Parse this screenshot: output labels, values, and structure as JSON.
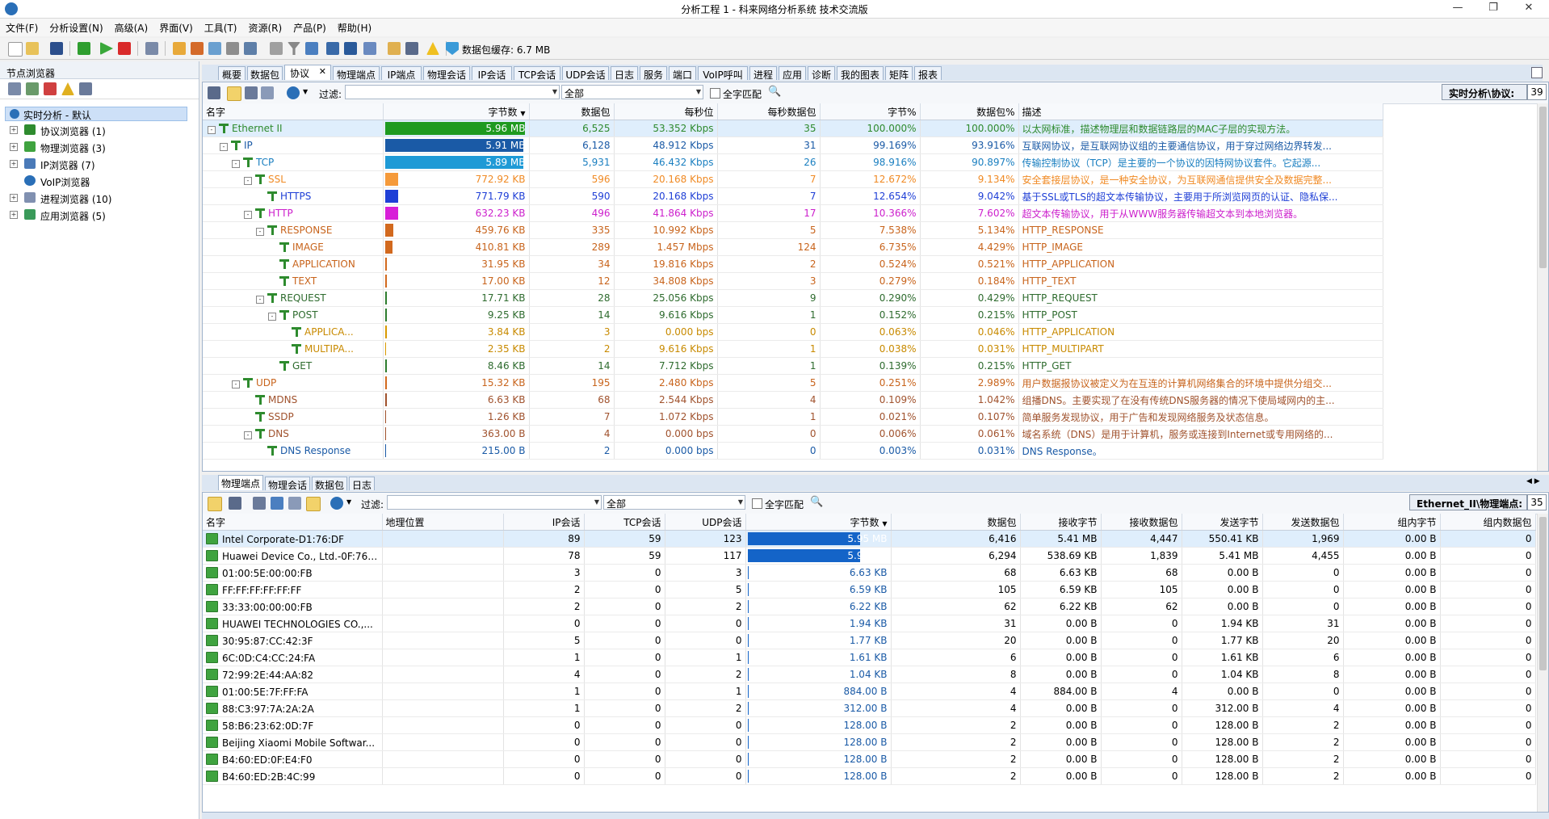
{
  "window": {
    "title": "分析工程 1 - 科来网络分析系统 技术交流版"
  },
  "menu": [
    "文件(F)",
    "分析设置(N)",
    "高级(A)",
    "界面(V)",
    "工具(T)",
    "资源(R)",
    "产品(P)",
    "帮助(H)"
  ],
  "toolbar": {
    "cache_label": "数据包缓存: 6.7 MB"
  },
  "left_panel": {
    "title": "节点浏览器",
    "root": "实时分析 - 默认",
    "items": [
      "协议浏览器 (1)",
      "物理浏览器 (3)",
      "IP浏览器 (7)",
      "VoIP浏览器",
      "进程浏览器 (10)",
      "应用浏览器 (5)"
    ]
  },
  "tabs": [
    "概要",
    "数据包",
    "协议",
    "物理端点",
    "IP端点",
    "物理会话",
    "IP会话",
    "TCP会话",
    "UDP会话",
    "日志",
    "服务",
    "端口",
    "VoIP呼叫",
    "进程",
    "应用",
    "诊断",
    "我的图表",
    "矩阵",
    "报表"
  ],
  "active_tab": "协议",
  "protocol_panel": {
    "filter_label": "过滤:",
    "filter_value": "",
    "scope_value": "全部",
    "match_label": "全字匹配",
    "path_label": "实时分析\\协议:",
    "count": "39",
    "columns": [
      "名字",
      "字节数",
      "数据包",
      "每秒位",
      "每秒数据包",
      "字节%",
      "数据包%",
      "描述"
    ],
    "rows": [
      {
        "name": "Ethernet II",
        "level": 0,
        "exp": "-",
        "bytes": "5.96 MB",
        "bar": 1.0,
        "bar_color": "#1f9a1f",
        "packets": "6,525",
        "bps": "53.352 Kbps",
        "pps": "35",
        "bpct": "100.000%",
        "ppct": "100.000%",
        "desc": "以太网标准，描述物理层和数据链路层的MAC子层的实现方法。",
        "color": "#2d8a2d"
      },
      {
        "name": "IP",
        "level": 1,
        "exp": "-",
        "bytes": "5.91 MB",
        "bar": 0.992,
        "bar_color": "#1a5aa6",
        "packets": "6,128",
        "bps": "48.912 Kbps",
        "pps": "31",
        "bpct": "99.169%",
        "ppct": "93.916%",
        "desc": "互联网协议，是互联网协议组的主要通信协议，用于穿过网络边界转发...",
        "color": "#1a5aa6"
      },
      {
        "name": "TCP",
        "level": 2,
        "exp": "-",
        "bytes": "5.89 MB",
        "bar": 0.99,
        "bar_color": "#1e9ad6",
        "packets": "5,931",
        "bps": "46.432 Kbps",
        "pps": "26",
        "bpct": "98.916%",
        "ppct": "90.897%",
        "desc": "传输控制协议（TCP）是主要的一个协议的因特网协议套件。它起源...",
        "color": "#1a7fc0"
      },
      {
        "name": "SSL",
        "level": 3,
        "exp": "-",
        "bytes": "772.92 KB",
        "bar": 0.127,
        "bar_color": "#f59a3a",
        "packets": "596",
        "bps": "20.168 Kbps",
        "pps": "7",
        "bpct": "12.672%",
        "ppct": "9.134%",
        "desc": "安全套接层协议，是一种安全协议，为互联网通信提供安全及数据完整...",
        "color": "#f08a24"
      },
      {
        "name": "HTTPS",
        "level": 4,
        "exp": "",
        "bytes": "771.79 KB",
        "bar": 0.127,
        "bar_color": "#1f3fd6",
        "packets": "590",
        "bps": "20.168 Kbps",
        "pps": "7",
        "bpct": "12.654%",
        "ppct": "9.042%",
        "desc": "基于SSL或TLS的超文本传输协议，主要用于所浏览网页的认证、隐私保...",
        "color": "#1f3fd6"
      },
      {
        "name": "HTTP",
        "level": 3,
        "exp": "-",
        "bytes": "632.23 KB",
        "bar": 0.104,
        "bar_color": "#d81fd8",
        "packets": "496",
        "bps": "41.864 Kbps",
        "pps": "17",
        "bpct": "10.366%",
        "ppct": "7.602%",
        "desc": "超文本传输协议，用于从WWW服务器传输超文本到本地浏览器。",
        "color": "#cc1fcc"
      },
      {
        "name": "RESPONSE",
        "level": 4,
        "exp": "-",
        "bytes": "459.76 KB",
        "bar": 0.075,
        "bar_color": "#d2691e",
        "packets": "335",
        "bps": "10.992 Kbps",
        "pps": "5",
        "bpct": "7.538%",
        "ppct": "5.134%",
        "desc": "HTTP_RESPONSE",
        "color": "#c8641c"
      },
      {
        "name": "IMAGE",
        "level": 5,
        "exp": "",
        "bytes": "410.81 KB",
        "bar": 0.067,
        "bar_color": "#d2691e",
        "packets": "289",
        "bps": "1.457 Mbps",
        "pps": "124",
        "bpct": "6.735%",
        "ppct": "4.429%",
        "desc": "HTTP_IMAGE",
        "color": "#c8641c"
      },
      {
        "name": "APPLICATION",
        "level": 5,
        "exp": "",
        "bytes": "31.95 KB",
        "bar": 0.005,
        "bar_color": "#d2691e",
        "packets": "34",
        "bps": "19.816 Kbps",
        "pps": "2",
        "bpct": "0.524%",
        "ppct": "0.521%",
        "desc": "HTTP_APPLICATION",
        "color": "#c8641c"
      },
      {
        "name": "TEXT",
        "level": 5,
        "exp": "",
        "bytes": "17.00 KB",
        "bar": 0.003,
        "bar_color": "#d2691e",
        "packets": "12",
        "bps": "34.808 Kbps",
        "pps": "3",
        "bpct": "0.279%",
        "ppct": "0.184%",
        "desc": "HTTP_TEXT",
        "color": "#c8641c"
      },
      {
        "name": "REQUEST",
        "level": 4,
        "exp": "-",
        "bytes": "17.71 KB",
        "bar": 0.003,
        "bar_color": "#2e7d2e",
        "packets": "28",
        "bps": "25.056 Kbps",
        "pps": "9",
        "bpct": "0.290%",
        "ppct": "0.429%",
        "desc": "HTTP_REQUEST",
        "color": "#2e6b2e"
      },
      {
        "name": "POST",
        "level": 5,
        "exp": "-",
        "bytes": "9.25 KB",
        "bar": 0.0015,
        "bar_color": "#2e7d2e",
        "packets": "14",
        "bps": "9.616 Kbps",
        "pps": "1",
        "bpct": "0.152%",
        "ppct": "0.215%",
        "desc": "HTTP_POST",
        "color": "#2e6b2e"
      },
      {
        "name": "APPLICA...",
        "level": 6,
        "exp": "",
        "bytes": "3.84 KB",
        "bar": 0.0006,
        "bar_color": "#d99a00",
        "packets": "3",
        "bps": "0.000 bps",
        "pps": "0",
        "bpct": "0.063%",
        "ppct": "0.046%",
        "desc": "HTTP_APPLICATION",
        "color": "#c88a00"
      },
      {
        "name": "MULTIPA...",
        "level": 6,
        "exp": "",
        "bytes": "2.35 KB",
        "bar": 0.0004,
        "bar_color": "#d99a00",
        "packets": "2",
        "bps": "9.616 Kbps",
        "pps": "1",
        "bpct": "0.038%",
        "ppct": "0.031%",
        "desc": "HTTP_MULTIPART",
        "color": "#c88a00"
      },
      {
        "name": "GET",
        "level": 5,
        "exp": "",
        "bytes": "8.46 KB",
        "bar": 0.0014,
        "bar_color": "#2e7d2e",
        "packets": "14",
        "bps": "7.712 Kbps",
        "pps": "1",
        "bpct": "0.139%",
        "ppct": "0.215%",
        "desc": "HTTP_GET",
        "color": "#2e6b2e"
      },
      {
        "name": "UDP",
        "level": 2,
        "exp": "-",
        "bytes": "15.32 KB",
        "bar": 0.0025,
        "bar_color": "#d2691e",
        "packets": "195",
        "bps": "2.480 Kbps",
        "pps": "5",
        "bpct": "0.251%",
        "ppct": "2.989%",
        "desc": "用户数据报协议被定义为在互连的计算机网络集合的环境中提供分组交...",
        "color": "#c8641c"
      },
      {
        "name": "MDNS",
        "level": 3,
        "exp": "",
        "bytes": "6.63 KB",
        "bar": 0.001,
        "bar_color": "#a0522d",
        "packets": "68",
        "bps": "2.544 Kbps",
        "pps": "4",
        "bpct": "0.109%",
        "ppct": "1.042%",
        "desc": "组播DNS。主要实现了在没有传统DNS服务器的情况下使局域网内的主...",
        "color": "#a0522d"
      },
      {
        "name": "SSDP",
        "level": 3,
        "exp": "",
        "bytes": "1.26 KB",
        "bar": 0.0002,
        "bar_color": "#a0522d",
        "packets": "7",
        "bps": "1.072 Kbps",
        "pps": "1",
        "bpct": "0.021%",
        "ppct": "0.107%",
        "desc": "简单服务发现协议，用于广告和发现网络服务及状态信息。",
        "color": "#a0522d"
      },
      {
        "name": "DNS",
        "level": 3,
        "exp": "-",
        "bytes": "363.00 B",
        "bar": 0.0001,
        "bar_color": "#a0522d",
        "packets": "4",
        "bps": "0.000 bps",
        "pps": "0",
        "bpct": "0.006%",
        "ppct": "0.061%",
        "desc": "域名系统（DNS）是用于计算机，服务或连接到Internet或专用网络的...",
        "color": "#a0522d"
      },
      {
        "name": "DNS Response",
        "level": 4,
        "exp": "",
        "bytes": "215.00 B",
        "bar": 0.0001,
        "bar_color": "#1a5aa6",
        "packets": "2",
        "bps": "0.000 bps",
        "pps": "0",
        "bpct": "0.003%",
        "ppct": "0.031%",
        "desc": "DNS Response。",
        "color": "#1a5aa6"
      }
    ]
  },
  "bottom_tabs": [
    "物理端点",
    "物理会话",
    "数据包",
    "日志"
  ],
  "bottom_active_tab": "物理端点",
  "physical_panel": {
    "filter_label": "过滤:",
    "filter_value": "",
    "scope_value": "全部",
    "match_label": "全字匹配",
    "path_label": "Ethernet_II\\物理端点:",
    "count": "35",
    "columns": [
      "名字",
      "地理位置",
      "IP会话",
      "TCP会话",
      "UDP会话",
      "字节数",
      "数据包",
      "接收字节",
      "接收数据包",
      "发送字节",
      "发送数据包",
      "组内字节",
      "组内数据包"
    ],
    "rows": [
      {
        "name": "Intel Corporate-D1:76:DF",
        "geo": "",
        "ip": "89",
        "tcp": "59",
        "udp": "123",
        "bytes": "5.95 MB",
        "bar": 0.998,
        "packets": "6,416",
        "rx": "5.41 MB",
        "rxp": "4,447",
        "tx": "550.41 KB",
        "txp": "1,969",
        "gb": "0.00 B",
        "gp": "0"
      },
      {
        "name": "Huawei Device Co., Ltd.-0F:76:26",
        "geo": "",
        "ip": "78",
        "tcp": "59",
        "udp": "117",
        "bytes": "5.94 MB",
        "bar": 0.996,
        "packets": "6,294",
        "rx": "538.69 KB",
        "rxp": "1,839",
        "tx": "5.41 MB",
        "txp": "4,455",
        "gb": "0.00 B",
        "gp": "0"
      },
      {
        "name": "01:00:5E:00:00:FB",
        "geo": "",
        "ip": "3",
        "tcp": "0",
        "udp": "3",
        "bytes": "6.63 KB",
        "bar": 0.001,
        "packets": "68",
        "rx": "6.63 KB",
        "rxp": "68",
        "tx": "0.00 B",
        "txp": "0",
        "gb": "0.00 B",
        "gp": "0"
      },
      {
        "name": "FF:FF:FF:FF:FF:FF",
        "geo": "",
        "ip": "2",
        "tcp": "0",
        "udp": "5",
        "bytes": "6.59 KB",
        "bar": 0.001,
        "packets": "105",
        "rx": "6.59 KB",
        "rxp": "105",
        "tx": "0.00 B",
        "txp": "0",
        "gb": "0.00 B",
        "gp": "0"
      },
      {
        "name": "33:33:00:00:00:FB",
        "geo": "",
        "ip": "2",
        "tcp": "0",
        "udp": "2",
        "bytes": "6.22 KB",
        "bar": 0.001,
        "packets": "62",
        "rx": "6.22 KB",
        "rxp": "62",
        "tx": "0.00 B",
        "txp": "0",
        "gb": "0.00 B",
        "gp": "0"
      },
      {
        "name": "HUAWEI TECHNOLOGIES CO.,...",
        "geo": "",
        "ip": "0",
        "tcp": "0",
        "udp": "0",
        "bytes": "1.94 KB",
        "bar": 0.0003,
        "packets": "31",
        "rx": "0.00 B",
        "rxp": "0",
        "tx": "1.94 KB",
        "txp": "31",
        "gb": "0.00 B",
        "gp": "0"
      },
      {
        "name": "30:95:87:CC:42:3F",
        "geo": "",
        "ip": "5",
        "tcp": "0",
        "udp": "0",
        "bytes": "1.77 KB",
        "bar": 0.0003,
        "packets": "20",
        "rx": "0.00 B",
        "rxp": "0",
        "tx": "1.77 KB",
        "txp": "20",
        "gb": "0.00 B",
        "gp": "0"
      },
      {
        "name": "6C:0D:C4:CC:24:FA",
        "geo": "",
        "ip": "1",
        "tcp": "0",
        "udp": "1",
        "bytes": "1.61 KB",
        "bar": 0.0003,
        "packets": "6",
        "rx": "0.00 B",
        "rxp": "0",
        "tx": "1.61 KB",
        "txp": "6",
        "gb": "0.00 B",
        "gp": "0"
      },
      {
        "name": "72:99:2E:44:AA:82",
        "geo": "",
        "ip": "4",
        "tcp": "0",
        "udp": "2",
        "bytes": "1.04 KB",
        "bar": 0.0002,
        "packets": "8",
        "rx": "0.00 B",
        "rxp": "0",
        "tx": "1.04 KB",
        "txp": "8",
        "gb": "0.00 B",
        "gp": "0"
      },
      {
        "name": "01:00:5E:7F:FF:FA",
        "geo": "",
        "ip": "1",
        "tcp": "0",
        "udp": "1",
        "bytes": "884.00 B",
        "bar": 0.0001,
        "packets": "4",
        "rx": "884.00 B",
        "rxp": "4",
        "tx": "0.00 B",
        "txp": "0",
        "gb": "0.00 B",
        "gp": "0"
      },
      {
        "name": "88:C3:97:7A:2A:2A",
        "geo": "",
        "ip": "1",
        "tcp": "0",
        "udp": "2",
        "bytes": "312.00 B",
        "bar": 0.0001,
        "packets": "4",
        "rx": "0.00 B",
        "rxp": "0",
        "tx": "312.00 B",
        "txp": "4",
        "gb": "0.00 B",
        "gp": "0"
      },
      {
        "name": "58:B6:23:62:0D:7F",
        "geo": "",
        "ip": "0",
        "tcp": "0",
        "udp": "0",
        "bytes": "128.00 B",
        "bar": 0.0001,
        "packets": "2",
        "rx": "0.00 B",
        "rxp": "0",
        "tx": "128.00 B",
        "txp": "2",
        "gb": "0.00 B",
        "gp": "0"
      },
      {
        "name": "Beijing Xiaomi Mobile Softwar...",
        "geo": "",
        "ip": "0",
        "tcp": "0",
        "udp": "0",
        "bytes": "128.00 B",
        "bar": 0.0001,
        "packets": "2",
        "rx": "0.00 B",
        "rxp": "0",
        "tx": "128.00 B",
        "txp": "2",
        "gb": "0.00 B",
        "gp": "0"
      },
      {
        "name": "B4:60:ED:0F:E4:F0",
        "geo": "",
        "ip": "0",
        "tcp": "0",
        "udp": "0",
        "bytes": "128.00 B",
        "bar": 0.0001,
        "packets": "2",
        "rx": "0.00 B",
        "rxp": "0",
        "tx": "128.00 B",
        "txp": "2",
        "gb": "0.00 B",
        "gp": "0"
      },
      {
        "name": "B4:60:ED:2B:4C:99",
        "geo": "",
        "ip": "0",
        "tcp": "0",
        "udp": "0",
        "bytes": "128.00 B",
        "bar": 0.0001,
        "packets": "2",
        "rx": "0.00 B",
        "rxp": "0",
        "tx": "128.00 B",
        "txp": "2",
        "gb": "0.00 B",
        "gp": "0"
      }
    ]
  }
}
